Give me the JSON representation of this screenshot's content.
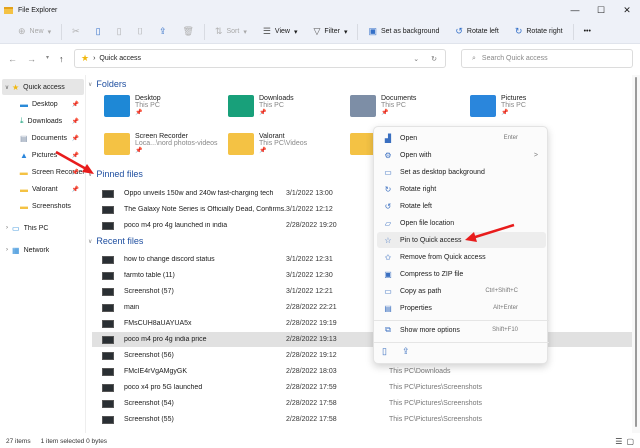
{
  "window": {
    "title": "File Explorer",
    "controls": [
      "—",
      "☐",
      "✕"
    ]
  },
  "toolbar": {
    "new": "New",
    "sort": "Sort",
    "view": "View",
    "filter": "Filter",
    "set_bg": "Set as background",
    "rotate_left": "Rotate left",
    "rotate_right": "Rotate right",
    "more": "•••"
  },
  "address": {
    "path": "Quick access",
    "search_placeholder": "Search Quick access"
  },
  "sidebar": {
    "items": [
      {
        "label": "Quick access",
        "kind": "quick"
      },
      {
        "label": "Desktop",
        "kind": "desktop"
      },
      {
        "label": "Downloads",
        "kind": "downloads"
      },
      {
        "label": "Documents",
        "kind": "documents"
      },
      {
        "label": "Pictures",
        "kind": "pictures"
      },
      {
        "label": "Screen Recorder",
        "kind": "folder"
      },
      {
        "label": "Valorant",
        "kind": "folder"
      },
      {
        "label": "Screenshots",
        "kind": "folder"
      },
      {
        "label": "This PC",
        "kind": "pc"
      },
      {
        "label": "Network",
        "kind": "network"
      }
    ]
  },
  "sections": {
    "folders": "Folders",
    "pinned": "Pinned files",
    "recent": "Recent files"
  },
  "folders": [
    {
      "name": "Desktop",
      "sub": "This PC",
      "color": "#1e88d6"
    },
    {
      "name": "Downloads",
      "sub": "This PC",
      "color": "#18a07a"
    },
    {
      "name": "Documents",
      "sub": "This PC",
      "color": "#7d8ea6"
    },
    {
      "name": "Pictures",
      "sub": "This PC",
      "color": "#2a86dc"
    },
    {
      "name": "Screen Recorder",
      "sub": "Loca...\\nord photos-videos",
      "color": "#f4c244"
    },
    {
      "name": "Valorant",
      "sub": "This PC\\Videos",
      "color": "#f4c244"
    },
    {
      "name": "",
      "sub": "",
      "color": "#f4c244"
    }
  ],
  "pinned": [
    {
      "name": "Oppo unveils 150w and 240w fast-charging tech",
      "date": "3/1/2022 13:00"
    },
    {
      "name": "The Galaxy Note Series is Officially Dead, Confirms...",
      "date": "3/1/2022 12:12"
    },
    {
      "name": "poco m4 pro 4g launched in india",
      "date": "2/28/2022 19:20"
    }
  ],
  "recent": [
    {
      "name": "how to change discord status",
      "date": "3/1/2022 12:31",
      "loc": ""
    },
    {
      "name": "farmto table (11)",
      "date": "3/1/2022 12:30",
      "loc": ""
    },
    {
      "name": "Screenshot (57)",
      "date": "3/1/2022 12:21",
      "loc": ""
    },
    {
      "name": "main",
      "date": "2/28/2022 22:21",
      "loc": ""
    },
    {
      "name": "FMsCUH8aUAYUA5x",
      "date": "2/28/2022 19:19",
      "loc": ""
    },
    {
      "name": "poco m4 pro 4g india price",
      "date": "2/28/2022 19:13",
      "loc": "",
      "selected": true
    },
    {
      "name": "Screenshot (56)",
      "date": "2/28/2022 19:12",
      "loc": ""
    },
    {
      "name": "FMcIE4rVgAMgyGK",
      "date": "2/28/2022 18:03",
      "loc": "This PC\\Downloads"
    },
    {
      "name": "poco x4 pro 5G launched",
      "date": "2/28/2022 17:59",
      "loc": "This PC\\Pictures\\Screenshots"
    },
    {
      "name": "Screenshot (54)",
      "date": "2/28/2022 17:58",
      "loc": "This PC\\Pictures\\Screenshots"
    },
    {
      "name": "Screenshot (55)",
      "date": "2/28/2022 17:58",
      "loc": "This PC\\Pictures\\Screenshots"
    }
  ],
  "context_menu": {
    "items": [
      {
        "label": "Open",
        "shortcut": "Enter",
        "icon": "▟"
      },
      {
        "label": "Open with",
        "shortcut": "",
        "icon": "⚙",
        "submenu": ">"
      },
      {
        "label": "Set as desktop background",
        "shortcut": "",
        "icon": "▭"
      },
      {
        "label": "Rotate right",
        "shortcut": "",
        "icon": "↻"
      },
      {
        "label": "Rotate left",
        "shortcut": "",
        "icon": "↺"
      },
      {
        "label": "Open file location",
        "shortcut": "",
        "icon": "▱"
      },
      {
        "label": "Pin to Quick access",
        "shortcut": "",
        "icon": "☆",
        "highlight": true
      },
      {
        "label": "Remove from Quick access",
        "shortcut": "",
        "icon": "✩"
      },
      {
        "label": "Compress to ZIP file",
        "shortcut": "",
        "icon": "▣"
      },
      {
        "label": "Copy as path",
        "shortcut": "Ctrl+Shift+C",
        "icon": "▭"
      },
      {
        "label": "Properties",
        "shortcut": "Alt+Enter",
        "icon": "▤"
      }
    ],
    "show_more": {
      "label": "Show more options",
      "shortcut": "Shift+F10"
    }
  },
  "status": {
    "count": "27 items",
    "selection": "1 item selected  0 bytes"
  },
  "colors": {
    "accent": "#1f4fa0",
    "arrow": "#e81c1c"
  }
}
